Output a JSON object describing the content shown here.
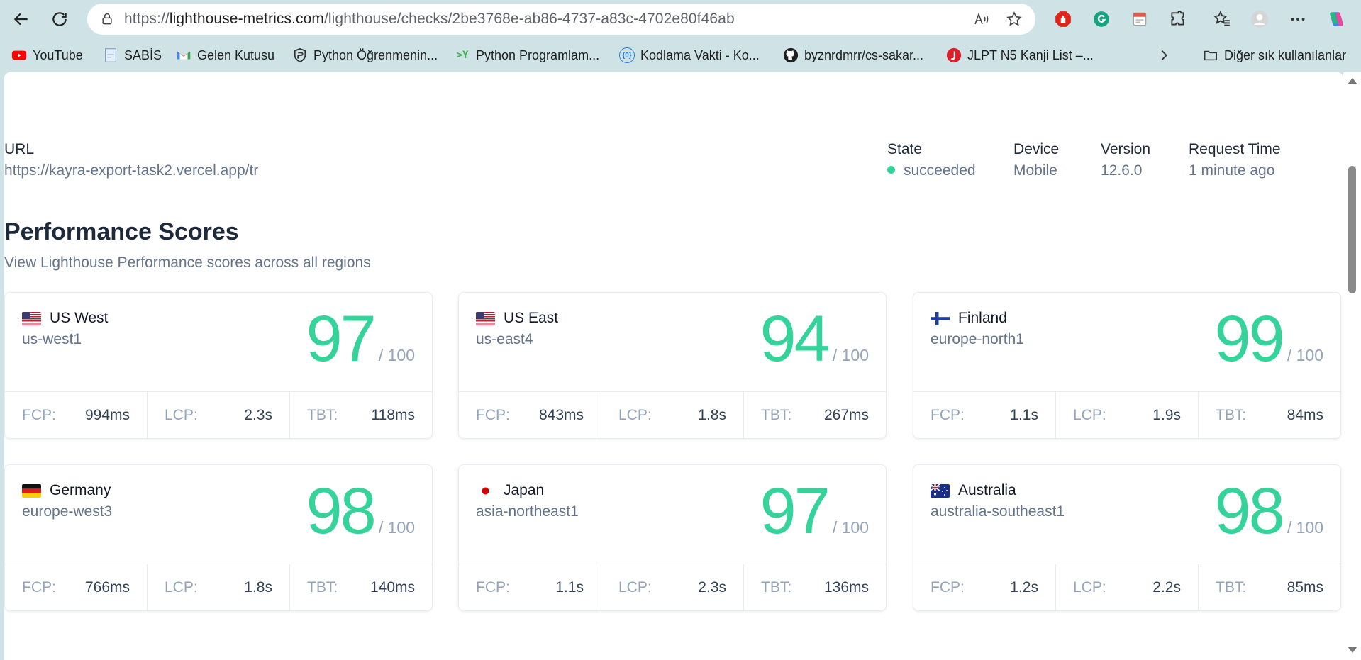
{
  "browser": {
    "url_prefix": "https://",
    "url_host": "lighthouse-metrics.com",
    "url_path": "/lighthouse/checks/2be3768e-ab86-4737-a83c-4702e80f46ab"
  },
  "bookmarks": [
    {
      "label": "YouTube",
      "icon": "youtube-icon",
      "color": "#ff0000"
    },
    {
      "label": "SABİS",
      "icon": "document-icon",
      "color": "#6b8fbf"
    },
    {
      "label": "Gelen Kutusu",
      "icon": "gmail-icon",
      "color": "#ea4335"
    },
    {
      "label": "Python Öğrenmenin...",
      "icon": "shield-icon",
      "color": "#333333"
    },
    {
      "label": "Python Programlam...",
      "icon": "ycombinator-icon",
      "color": "#3ab44a"
    },
    {
      "label": "Kodlama Vakti - Ko...",
      "icon": "code-icon",
      "color": "#2a7bd6"
    },
    {
      "label": "byznrdmrr/cs-sakar...",
      "icon": "github-icon",
      "color": "#1f1f1f"
    },
    {
      "label": "JLPT N5 Kanji List –...",
      "icon": "jlpt-icon",
      "color": "#e11d2a"
    }
  ],
  "other_bookmarks": "Diğer sık kullanılanlar",
  "meta": {
    "url_label": "URL",
    "url_value": "https://kayra-export-task2.vercel.app/tr",
    "state_label": "State",
    "state_value": "succeeded",
    "device_label": "Device",
    "device_value": "Mobile",
    "version_label": "Version",
    "version_value": "12.6.0",
    "request_label": "Request Time",
    "request_value": "1 minute ago"
  },
  "section": {
    "title": "Performance Scores",
    "subtitle": "View Lighthouse Performance scores across all regions"
  },
  "score_max": "/ 100",
  "metric_labels": {
    "fcp": "FCP:",
    "lcp": "LCP:",
    "tbt": "TBT:"
  },
  "colors": {
    "score": "#34d399",
    "status": "#34d399"
  },
  "regions": [
    {
      "name": "US West",
      "code": "us-west1",
      "flag": "us-flag-icon",
      "score": "97",
      "fcp": "994ms",
      "lcp": "2.3s",
      "tbt": "118ms"
    },
    {
      "name": "US East",
      "code": "us-east4",
      "flag": "us-flag-icon",
      "score": "94",
      "fcp": "843ms",
      "lcp": "1.8s",
      "tbt": "267ms"
    },
    {
      "name": "Finland",
      "code": "europe-north1",
      "flag": "finland-flag-icon",
      "score": "99",
      "fcp": "1.1s",
      "lcp": "1.9s",
      "tbt": "84ms"
    },
    {
      "name": "Germany",
      "code": "europe-west3",
      "flag": "germany-flag-icon",
      "score": "98",
      "fcp": "766ms",
      "lcp": "1.8s",
      "tbt": "140ms"
    },
    {
      "name": "Japan",
      "code": "asia-northeast1",
      "flag": "japan-flag-icon",
      "score": "97",
      "fcp": "1.1s",
      "lcp": "2.3s",
      "tbt": "136ms"
    },
    {
      "name": "Australia",
      "code": "australia-southeast1",
      "flag": "australia-flag-icon",
      "score": "98",
      "fcp": "1.2s",
      "lcp": "2.2s",
      "tbt": "85ms"
    }
  ]
}
